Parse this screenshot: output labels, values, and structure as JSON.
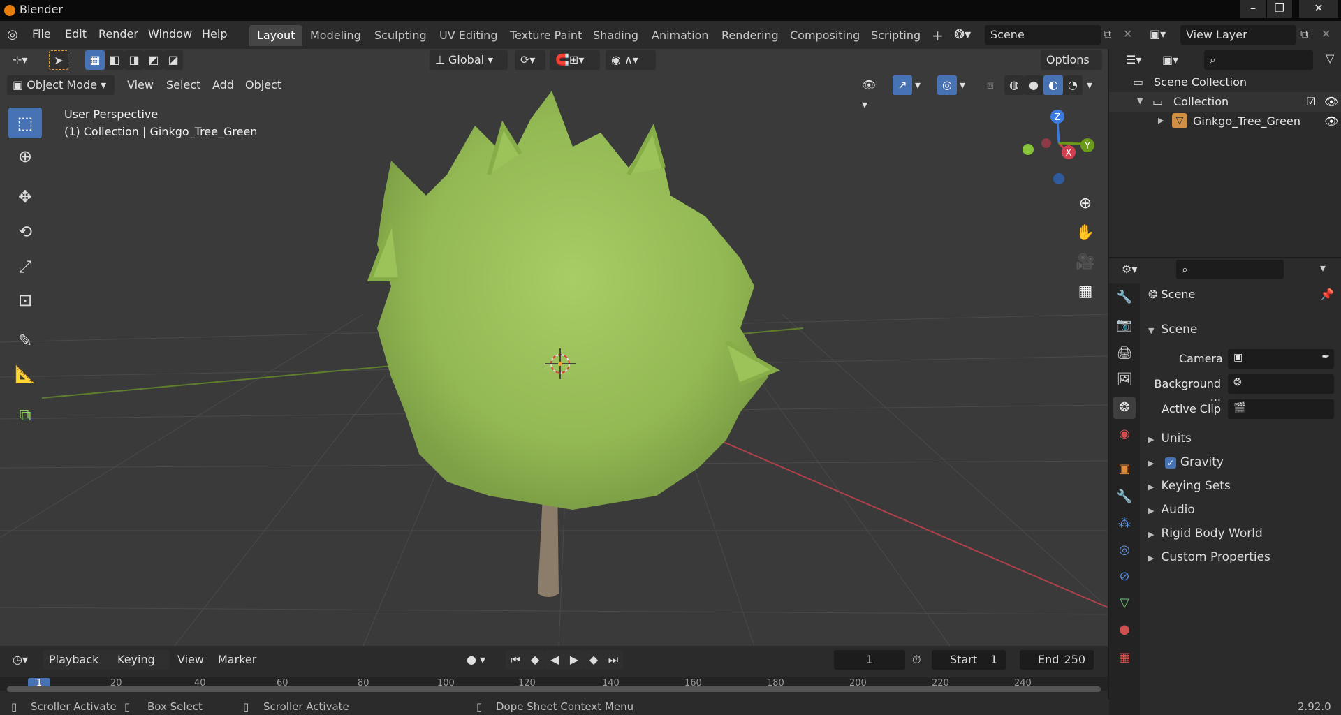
{
  "window": {
    "title": "Blender"
  },
  "menu": [
    "File",
    "Edit",
    "Render",
    "Window",
    "Help"
  ],
  "workspaces": [
    "Layout",
    "Modeling",
    "Sculpting",
    "UV Editing",
    "Texture Paint",
    "Shading",
    "Animation",
    "Rendering",
    "Compositing",
    "Scripting"
  ],
  "scene_field": "Scene",
  "view_layer_field": "View Layer",
  "tool_header": {
    "transform_orientation": "Global",
    "options": "Options"
  },
  "viewport_header": {
    "mode": "Object Mode",
    "view": "View",
    "select": "Select",
    "add": "Add",
    "object": "Object"
  },
  "viewport": {
    "perspective": "User Perspective",
    "collection_info": "(1) Collection | Ginkgo_Tree_Green"
  },
  "gizmo": {
    "z": "Z",
    "x": "X",
    "y": "Y"
  },
  "outliner": {
    "scene_collection": "Scene Collection",
    "collection": "Collection",
    "object": "Ginkgo_Tree_Green"
  },
  "properties": {
    "context": "Scene",
    "panel": "Scene",
    "camera_label": "Camera",
    "background_label": "Background ...",
    "active_clip_label": "Active Clip",
    "sections": [
      "Units",
      "Gravity",
      "Keying Sets",
      "Audio",
      "Rigid Body World",
      "Custom Properties"
    ]
  },
  "timeline": {
    "playback": "Playback",
    "keying": "Keying",
    "view": "View",
    "marker": "Marker",
    "current_frame": "1",
    "start_label": "Start",
    "start": "1",
    "end_label": "End",
    "end": "250",
    "ruler": [
      "1",
      "20",
      "40",
      "60",
      "80",
      "100",
      "120",
      "140",
      "160",
      "180",
      "200",
      "220",
      "240"
    ]
  },
  "status": {
    "scroller1": "Scroller Activate",
    "box_select": "Box Select",
    "scroller2": "Scroller Activate",
    "dope_sheet": "Dope Sheet Context Menu",
    "version": "2.92.0"
  },
  "colors": {
    "accent": "#4772b3",
    "x_axis": "#cf3f4f",
    "y_axis": "#6b9a1a",
    "z_axis": "#3b7be0",
    "tree": "#9dc25a"
  }
}
